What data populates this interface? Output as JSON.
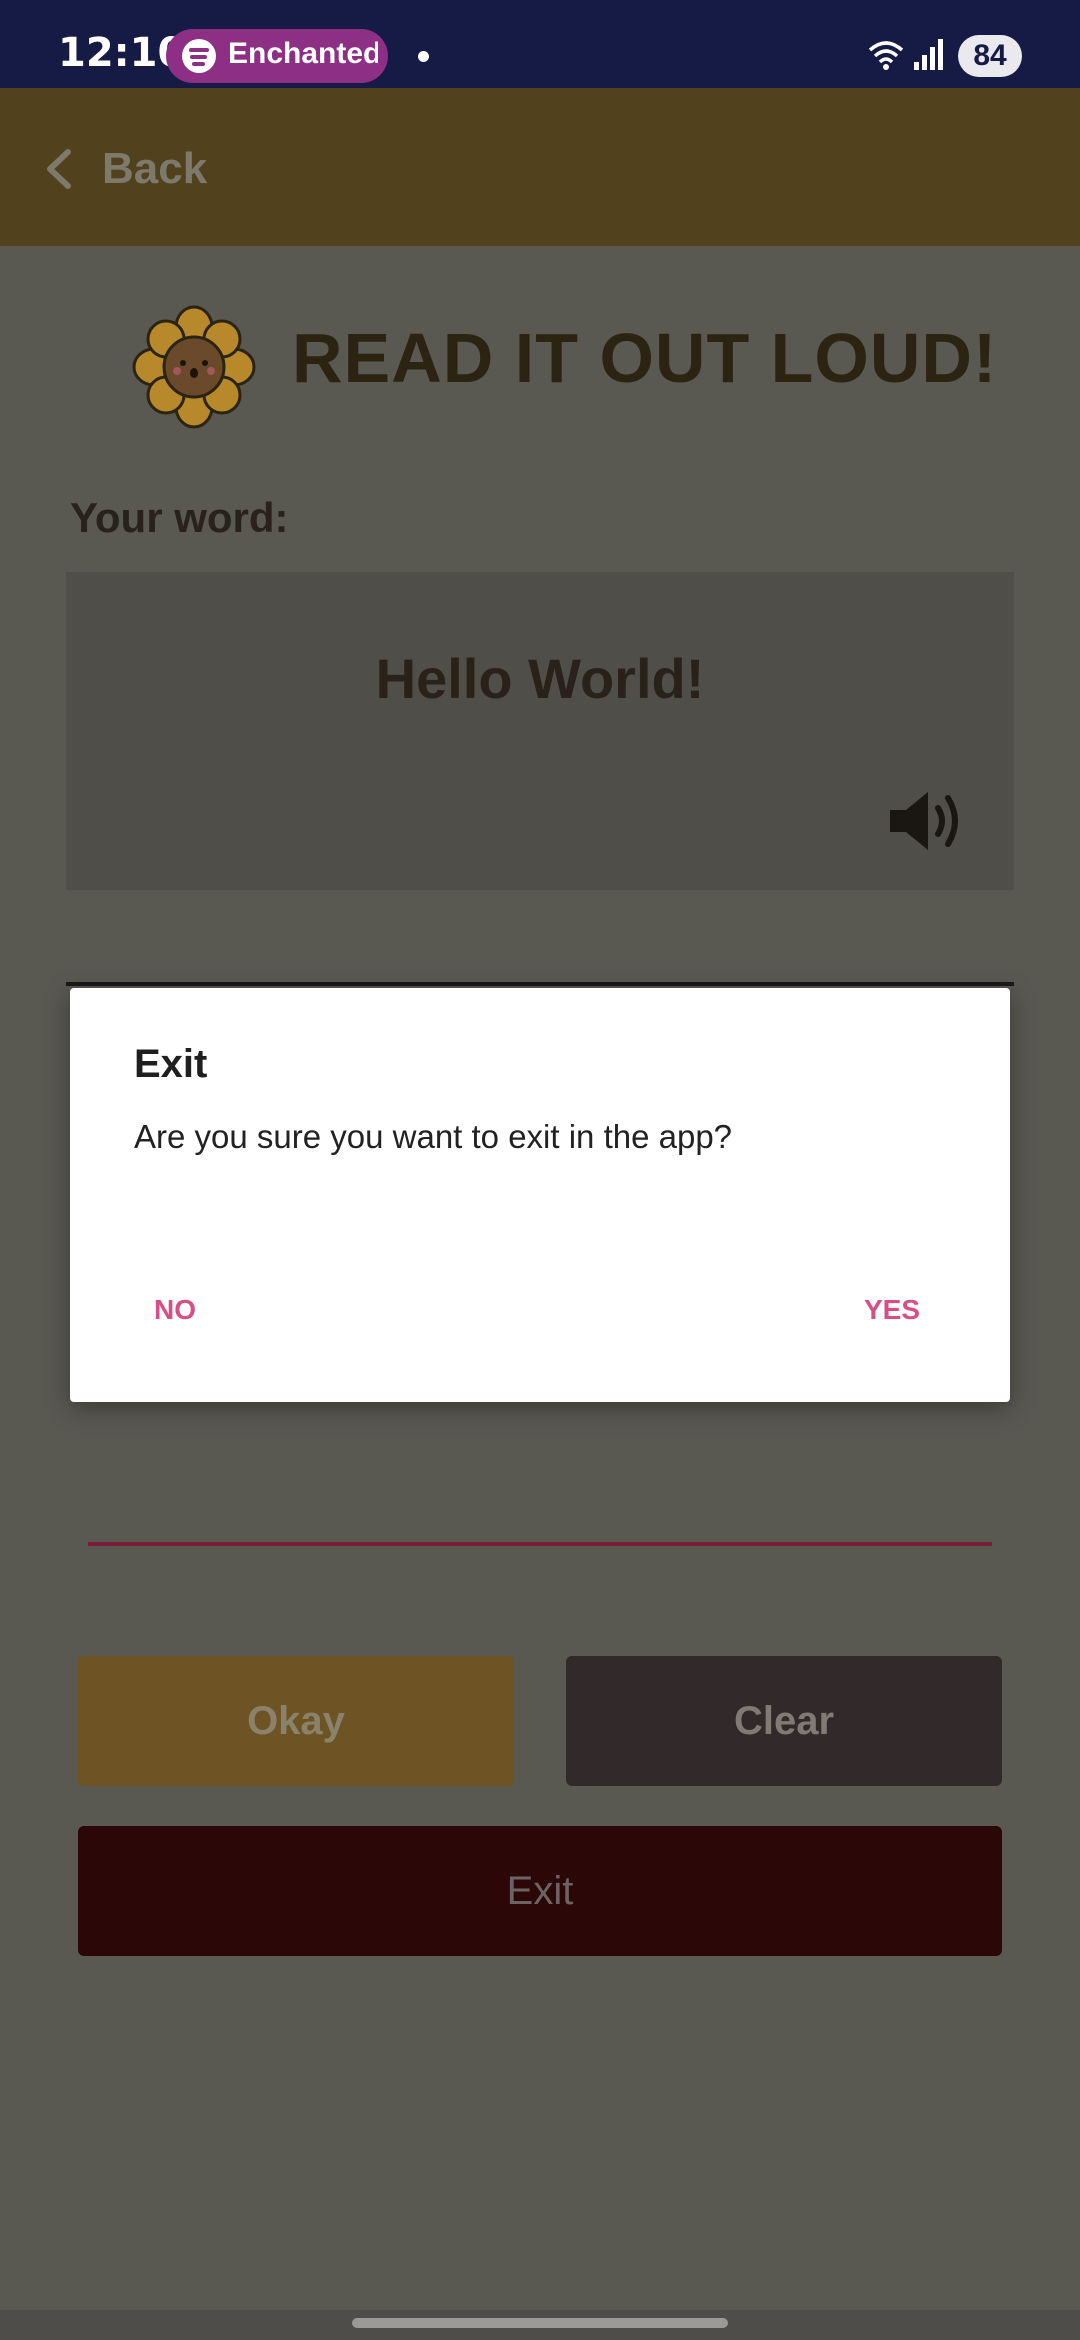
{
  "status_bar": {
    "time": "12:10",
    "media_pill_label": "Enchanted",
    "battery": "84"
  },
  "toolbar": {
    "back_label": "Back"
  },
  "main": {
    "heading": "READ IT OUT LOUD!",
    "word_label": "Your word:",
    "word_value": "Hello World!",
    "okay_label": "Okay",
    "clear_label": "Clear",
    "exit_label": "Exit"
  },
  "dialog": {
    "title": "Exit",
    "message": "Are you sure you want to exit in the app?",
    "no_label": "NO",
    "yes_label": "YES"
  },
  "colors": {
    "status_bar_bg": "#161b45",
    "toolbar_bg": "#51421d",
    "accent_pink": "#d64f86",
    "okay_bg": "#6e5424",
    "clear_bg": "#31292a",
    "exit_bg": "#2b0707"
  },
  "icons": [
    "spotify-icon",
    "wifi-icon",
    "signal-icon",
    "chevron-left-icon",
    "sunflower-icon",
    "speaker-icon"
  ]
}
